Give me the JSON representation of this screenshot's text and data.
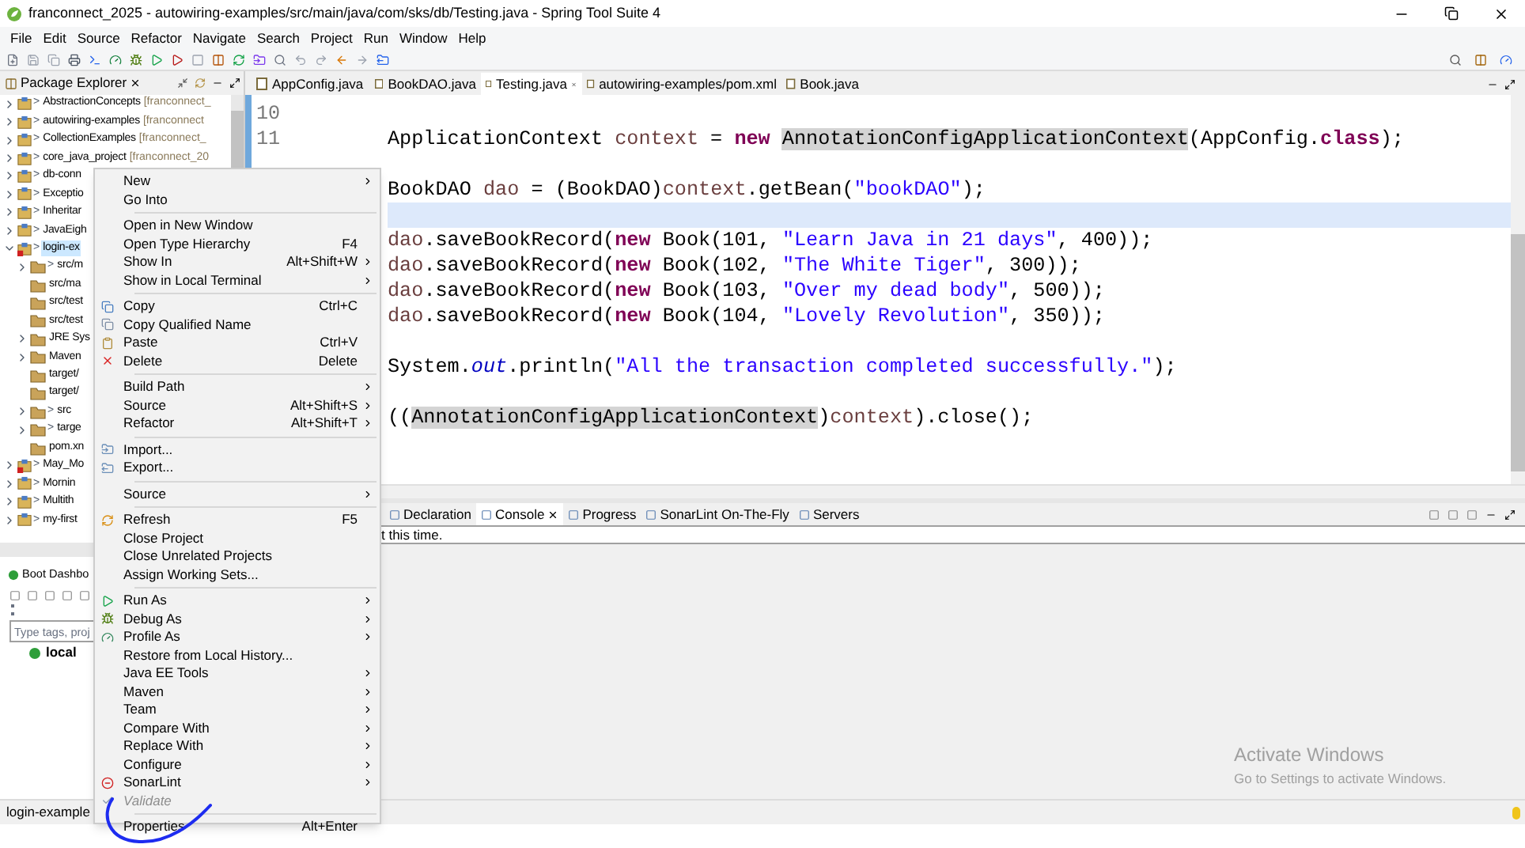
{
  "window": {
    "title": "franconnect_2025 - autowiring-examples/src/main/java/com/sks/db/Testing.java - Spring Tool Suite 4"
  },
  "menu_bar": [
    "File",
    "Edit",
    "Source",
    "Refactor",
    "Navigate",
    "Search",
    "Project",
    "Run",
    "Window",
    "Help"
  ],
  "package_explorer": {
    "title": "Package Explorer",
    "items": [
      {
        "prefix": ">",
        "label": "AbstractionConcepts",
        "repo": "[franconnect_",
        "expanded": false,
        "selected": false,
        "error": false
      },
      {
        "prefix": ">",
        "label": "autowiring-examples",
        "repo": "[franconnect",
        "expanded": false,
        "selected": false,
        "error": false
      },
      {
        "prefix": ">",
        "label": "CollectionExamples",
        "repo": "[franconnect_",
        "expanded": false,
        "selected": false,
        "error": false
      },
      {
        "prefix": ">",
        "label": "core_java_project",
        "repo": "[franconnect_20",
        "expanded": false,
        "selected": false,
        "error": false
      },
      {
        "prefix": ">",
        "label": "db-conn",
        "expanded": false,
        "selected": false,
        "error": false
      },
      {
        "prefix": ">",
        "label": "Exceptio",
        "expanded": false,
        "selected": false,
        "error": false
      },
      {
        "prefix": ">",
        "label": "Inheritar",
        "expanded": false,
        "selected": false,
        "error": false
      },
      {
        "prefix": ">",
        "label": "JavaEigh",
        "expanded": false,
        "selected": false,
        "error": false
      },
      {
        "prefix": ">",
        "label": "login-ex",
        "expanded": true,
        "selected": true,
        "error": true,
        "children": [
          {
            "prefix": ">",
            "label": "src/m",
            "has_children": true
          },
          {
            "label": "src/ma",
            "has_children": false
          },
          {
            "label": "src/test",
            "has_children": false
          },
          {
            "label": "src/test",
            "has_children": false
          },
          {
            "label": "JRE Sys",
            "has_children": true
          },
          {
            "label": "Maven",
            "has_children": true
          },
          {
            "label": "target/",
            "has_children": false
          },
          {
            "label": "target/",
            "has_children": false
          },
          {
            "prefix": ">",
            "label": "src",
            "has_children": true
          },
          {
            "prefix": ">",
            "label": "targe",
            "has_children": true
          },
          {
            "label": "pom.xn",
            "has_children": false
          }
        ]
      },
      {
        "prefix": ">",
        "label": "May_Mo",
        "expanded": false,
        "selected": false,
        "error": true
      },
      {
        "prefix": ">",
        "label": "Mornin",
        "expanded": false,
        "selected": false,
        "error": false
      },
      {
        "prefix": ">",
        "label": "Multith",
        "expanded": false,
        "selected": false,
        "error": false
      },
      {
        "prefix": ">",
        "label": "my-first",
        "expanded": false,
        "selected": false,
        "error": false
      }
    ]
  },
  "boot_dashboard": {
    "title": "Boot Dashbo",
    "search": {
      "placeholder": "Type tags, proj"
    },
    "items": [
      "local"
    ]
  },
  "editor": {
    "tabs": [
      {
        "label": "AppConfig.java",
        "selected": false
      },
      {
        "label": "BookDAO.java",
        "selected": false
      },
      {
        "label": "Testing.java",
        "selected": true
      },
      {
        "label": "autowiring-examples/pom.xml",
        "selected": false
      },
      {
        "label": "Book.java",
        "selected": false
      }
    ],
    "line_numbers": [
      "10",
      "11"
    ],
    "lines": [
      {
        "current": false
      },
      {
        "current": false,
        "tokens": [
          {
            "text": "ApplicationContext ",
            "kind": "plain"
          },
          {
            "text": "context",
            "kind": "variable"
          },
          {
            "text": " = ",
            "kind": "plain"
          },
          {
            "text": "new ",
            "kind": "keyword"
          },
          {
            "text": "AnnotationConfigApplicationContext",
            "kind": "occurrence"
          },
          {
            "text": "(AppConfig.",
            "kind": "plain"
          },
          {
            "text": "class",
            "kind": "keyword"
          },
          {
            "text": ");",
            "kind": "plain"
          }
        ]
      },
      {
        "current": false
      },
      {
        "current": false,
        "tokens": [
          {
            "text": "BookDAO ",
            "kind": "plain"
          },
          {
            "text": "dao",
            "kind": "variable"
          },
          {
            "text": " = (BookDAO)",
            "kind": "plain"
          },
          {
            "text": "context",
            "kind": "variable"
          },
          {
            "text": ".getBean(",
            "kind": "plain"
          },
          {
            "text": "\"bookDAO\"",
            "kind": "string"
          },
          {
            "text": ");",
            "kind": "plain"
          }
        ]
      },
      {
        "current": true
      },
      {
        "current": false,
        "tokens": [
          {
            "text": "dao",
            "kind": "variable"
          },
          {
            "text": ".saveBookRecord(",
            "kind": "plain"
          },
          {
            "text": "new",
            "kind": "keyword"
          },
          {
            "text": " Book(101, ",
            "kind": "plain"
          },
          {
            "text": "\"Learn Java in 21 days\"",
            "kind": "string"
          },
          {
            "text": ", 400));",
            "kind": "plain"
          }
        ]
      },
      {
        "current": false,
        "tokens": [
          {
            "text": "dao",
            "kind": "variable"
          },
          {
            "text": ".saveBookRecord(",
            "kind": "plain"
          },
          {
            "text": "new",
            "kind": "keyword"
          },
          {
            "text": " Book(102, ",
            "kind": "plain"
          },
          {
            "text": "\"The White Tiger\"",
            "kind": "string"
          },
          {
            "text": ", 300));",
            "kind": "plain"
          }
        ]
      },
      {
        "current": false,
        "tokens": [
          {
            "text": "dao",
            "kind": "variable"
          },
          {
            "text": ".saveBookRecord(",
            "kind": "plain"
          },
          {
            "text": "new",
            "kind": "keyword"
          },
          {
            "text": " Book(103, ",
            "kind": "plain"
          },
          {
            "text": "\"Over my dead body\"",
            "kind": "string"
          },
          {
            "text": ", 500));",
            "kind": "plain"
          }
        ]
      },
      {
        "current": false,
        "tokens": [
          {
            "text": "dao",
            "kind": "variable"
          },
          {
            "text": ".saveBookRecord(",
            "kind": "plain"
          },
          {
            "text": "new",
            "kind": "keyword"
          },
          {
            "text": " Book(104, ",
            "kind": "plain"
          },
          {
            "text": "\"Lovely Revolution\"",
            "kind": "string"
          },
          {
            "text": ", 350));",
            "kind": "plain"
          }
        ]
      },
      {
        "current": false
      },
      {
        "current": false,
        "tokens": [
          {
            "text": "System.",
            "kind": "plain"
          },
          {
            "text": "out",
            "kind": "field"
          },
          {
            "text": ".println(",
            "kind": "plain"
          },
          {
            "text": "\"All the transaction completed successfully.\"",
            "kind": "string"
          },
          {
            "text": ");",
            "kind": "plain"
          }
        ]
      },
      {
        "current": false
      },
      {
        "current": false,
        "tokens": [
          {
            "text": "((",
            "kind": "plain"
          },
          {
            "text": "AnnotationConfigApplicationContext",
            "kind": "occurrence"
          },
          {
            "text": ")",
            "kind": "plain"
          },
          {
            "text": "context",
            "kind": "variable"
          },
          {
            "text": ").close();",
            "kind": "plain"
          }
        ]
      }
    ]
  },
  "console": {
    "tabs": [
      {
        "label": "Declaration",
        "selected": false
      },
      {
        "label": "Console",
        "selected": true
      },
      {
        "label": "Progress",
        "selected": false
      },
      {
        "label": "SonarLint On-The-Fly",
        "selected": false
      },
      {
        "label": "Servers",
        "selected": false
      }
    ],
    "text": "t this time."
  },
  "status_bar": {
    "text": "login-example"
  },
  "context_menu": [
    {
      "kind": "item",
      "label": "New",
      "submenu": true,
      "disabled": false
    },
    {
      "kind": "item",
      "label": "Go Into",
      "submenu": false,
      "disabled": false
    },
    {
      "kind": "separator"
    },
    {
      "kind": "item",
      "label": "Open in New Window",
      "submenu": false,
      "disabled": false
    },
    {
      "kind": "item",
      "label": "Open Type Hierarchy",
      "shortcut": "F4",
      "submenu": false,
      "disabled": false
    },
    {
      "kind": "item",
      "label": "Show In",
      "shortcut": "Alt+Shift+W",
      "submenu": true,
      "disabled": false
    },
    {
      "kind": "item",
      "label": "Show in Local Terminal",
      "submenu": true,
      "disabled": false
    },
    {
      "kind": "separator"
    },
    {
      "kind": "item",
      "label": "Copy",
      "shortcut": "Ctrl+C",
      "submenu": false,
      "disabled": false
    },
    {
      "kind": "item",
      "label": "Copy Qualified Name",
      "submenu": false,
      "disabled": false
    },
    {
      "kind": "item",
      "label": "Paste",
      "shortcut": "Ctrl+V",
      "submenu": false,
      "disabled": false
    },
    {
      "kind": "item",
      "label": "Delete",
      "shortcut": "Delete",
      "submenu": false,
      "disabled": false
    },
    {
      "kind": "separator"
    },
    {
      "kind": "item",
      "label": "Build Path",
      "submenu": true,
      "disabled": false
    },
    {
      "kind": "item",
      "label": "Source",
      "shortcut": "Alt+Shift+S",
      "submenu": true,
      "disabled": false
    },
    {
      "kind": "item",
      "label": "Refactor",
      "shortcut": "Alt+Shift+T",
      "submenu": true,
      "disabled": false
    },
    {
      "kind": "separator"
    },
    {
      "kind": "item",
      "label": "Import...",
      "submenu": false,
      "disabled": false
    },
    {
      "kind": "item",
      "label": "Export...",
      "submenu": false,
      "disabled": false
    },
    {
      "kind": "separator"
    },
    {
      "kind": "item",
      "label": "Source",
      "submenu": true,
      "disabled": false
    },
    {
      "kind": "separator"
    },
    {
      "kind": "item",
      "label": "Refresh",
      "shortcut": "F5",
      "submenu": false,
      "disabled": false
    },
    {
      "kind": "item",
      "label": "Close Project",
      "submenu": false,
      "disabled": false
    },
    {
      "kind": "item",
      "label": "Close Unrelated Projects",
      "submenu": false,
      "disabled": false
    },
    {
      "kind": "item",
      "label": "Assign Working Sets...",
      "submenu": false,
      "disabled": false
    },
    {
      "kind": "separator"
    },
    {
      "kind": "item",
      "label": "Run As",
      "submenu": true,
      "disabled": false
    },
    {
      "kind": "item",
      "label": "Debug As",
      "submenu": true,
      "disabled": false
    },
    {
      "kind": "item",
      "label": "Profile As",
      "submenu": true,
      "disabled": false
    },
    {
      "kind": "item",
      "label": "Restore from Local History...",
      "submenu": false,
      "disabled": false
    },
    {
      "kind": "item",
      "label": "Java EE Tools",
      "submenu": true,
      "disabled": false
    },
    {
      "kind": "item",
      "label": "Maven",
      "submenu": true,
      "disabled": false
    },
    {
      "kind": "item",
      "label": "Team",
      "submenu": true,
      "disabled": false
    },
    {
      "kind": "item",
      "label": "Compare With",
      "submenu": true,
      "disabled": false
    },
    {
      "kind": "item",
      "label": "Replace With",
      "submenu": true,
      "disabled": false
    },
    {
      "kind": "item",
      "label": "Configure",
      "submenu": true,
      "disabled": false
    },
    {
      "kind": "item",
      "label": "SonarLint",
      "submenu": true,
      "disabled": false
    },
    {
      "kind": "item",
      "label": "Validate",
      "submenu": false,
      "disabled": true
    },
    {
      "kind": "separator"
    },
    {
      "kind": "item",
      "label": "Properties",
      "shortcut": "Alt+Enter",
      "submenu": false,
      "disabled": false
    }
  ],
  "os_notice": {
    "title": "Activate Windows",
    "text": "Go to Settings to activate Windows."
  }
}
